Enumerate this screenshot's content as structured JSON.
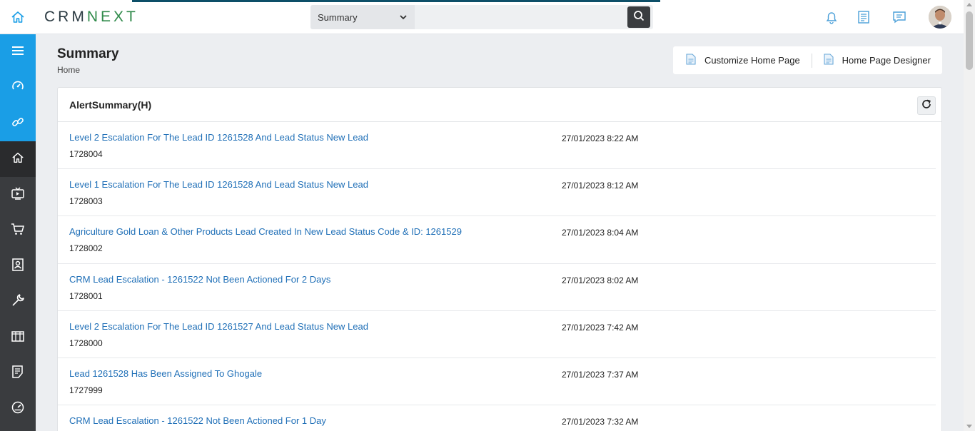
{
  "header": {
    "logo_left": "CRM",
    "logo_right": "NEXT",
    "search_scope": "Summary"
  },
  "page": {
    "title": "Summary",
    "breadcrumb": "Home",
    "actions": {
      "customize": "Customize Home Page",
      "designer": "Home Page Designer"
    }
  },
  "widget": {
    "title": "AlertSummary(H)",
    "alerts": [
      {
        "title": "Level 2 Escalation For The Lead ID 1261528 And Lead Status New Lead",
        "id": "1728004",
        "date": "27/01/2023 8:22 AM"
      },
      {
        "title": "Level 1 Escalation For The Lead ID 1261528 And Lead Status New Lead",
        "id": "1728003",
        "date": "27/01/2023 8:12 AM"
      },
      {
        "title": "Agriculture Gold Loan & Other Products Lead Created In New Lead Status Code & ID: 1261529",
        "id": "1728002",
        "date": "27/01/2023 8:04 AM"
      },
      {
        "title": "CRM Lead Escalation - 1261522 Not Been Actioned For 2 Days",
        "id": "1728001",
        "date": "27/01/2023 8:02 AM"
      },
      {
        "title": "Level 2 Escalation For The Lead ID 1261527 And Lead Status New Lead",
        "id": "1728000",
        "date": "27/01/2023 7:42 AM"
      },
      {
        "title": "Lead 1261528 Has Been Assigned To Ghogale",
        "id": "1727999",
        "date": "27/01/2023 7:37 AM"
      },
      {
        "title": "CRM Lead Escalation - 1261522 Not Been Actioned For 1 Day",
        "id": "",
        "date": "27/01/2023 7:32 AM"
      }
    ]
  },
  "icons": {
    "sidebar": [
      "menu-icon",
      "dashboard-gauge-icon",
      "link-icon",
      "home-icon",
      "tv-icon",
      "cart-icon",
      "contact-card-icon",
      "wrench-icon",
      "columns-icon",
      "notes-icon",
      "speedometer-icon"
    ],
    "header": [
      "home-icon",
      "bell-icon",
      "document-list-icon",
      "chat-icon"
    ]
  },
  "colors": {
    "brand_blue": "#1a9ee6",
    "sidebar_dark": "#3a3c3f",
    "link_blue": "#1f6fb7",
    "logo_green": "#2f8a4a"
  }
}
